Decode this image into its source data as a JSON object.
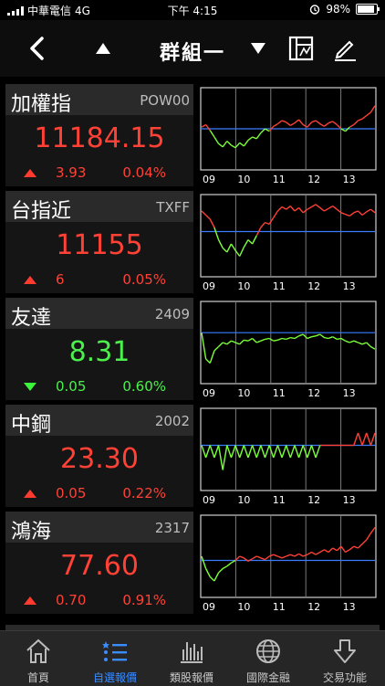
{
  "status": {
    "carrier": "中華電信",
    "network": "4G",
    "time": "下午 4:15",
    "battery": "98%"
  },
  "header": {
    "title": "群組一"
  },
  "colors": {
    "up": "#ff4136",
    "down": "#4cf04c",
    "accent": "#3b8cff"
  },
  "stocks": [
    {
      "name": "加權指",
      "code": "POW00",
      "price": "11184.15",
      "change": "3.93",
      "pct": "0.04%",
      "dir": "up",
      "chart": {
        "x_labels": [
          "09",
          "10",
          "11",
          "12",
          "13"
        ],
        "ref": 0.5,
        "series": [
          0.52,
          0.55,
          0.48,
          0.4,
          0.32,
          0.28,
          0.35,
          0.3,
          0.27,
          0.33,
          0.29,
          0.36,
          0.4,
          0.38,
          0.45,
          0.5,
          0.47,
          0.53,
          0.56,
          0.6,
          0.58,
          0.54,
          0.57,
          0.61,
          0.55,
          0.52,
          0.58,
          0.6,
          0.56,
          0.53,
          0.57,
          0.59,
          0.55,
          0.5,
          0.47,
          0.52,
          0.55,
          0.6,
          0.62,
          0.66,
          0.7,
          0.78
        ]
      }
    },
    {
      "name": "台指近",
      "code": "TXFF",
      "price": "11155",
      "change": "6",
      "pct": "0.05%",
      "dir": "up",
      "chart": {
        "x_labels": [
          "09",
          "10",
          "11",
          "12",
          "13"
        ],
        "ref": 0.55,
        "series": [
          0.8,
          0.75,
          0.7,
          0.6,
          0.45,
          0.35,
          0.3,
          0.4,
          0.32,
          0.25,
          0.36,
          0.45,
          0.4,
          0.5,
          0.6,
          0.66,
          0.64,
          0.72,
          0.8,
          0.85,
          0.82,
          0.86,
          0.8,
          0.84,
          0.78,
          0.82,
          0.85,
          0.88,
          0.84,
          0.8,
          0.83,
          0.86,
          0.82,
          0.78,
          0.76,
          0.74,
          0.78,
          0.8,
          0.75,
          0.79,
          0.82,
          0.78
        ]
      }
    },
    {
      "name": "友達",
      "code": "2409",
      "price": "8.31",
      "change": "0.05",
      "pct": "0.60%",
      "dir": "down",
      "chart": {
        "x_labels": [
          "09",
          "10",
          "11",
          "12",
          "13"
        ],
        "ref": 0.62,
        "series": [
          0.62,
          0.3,
          0.25,
          0.4,
          0.45,
          0.5,
          0.48,
          0.52,
          0.5,
          0.48,
          0.53,
          0.52,
          0.55,
          0.5,
          0.52,
          0.54,
          0.55,
          0.52,
          0.53,
          0.55,
          0.54,
          0.56,
          0.55,
          0.58,
          0.6,
          0.55,
          0.57,
          0.58,
          0.6,
          0.56,
          0.55,
          0.57,
          0.54,
          0.55,
          0.52,
          0.5,
          0.52,
          0.5,
          0.48,
          0.5,
          0.45,
          0.42
        ]
      }
    },
    {
      "name": "中鋼",
      "code": "2002",
      "price": "23.30",
      "change": "0.05",
      "pct": "0.22%",
      "dir": "up",
      "chart": {
        "x_labels": [
          "09",
          "10",
          "11",
          "12",
          "13"
        ],
        "ref": 0.55,
        "series": [
          0.55,
          0.4,
          0.55,
          0.4,
          0.55,
          0.25,
          0.55,
          0.4,
          0.55,
          0.4,
          0.55,
          0.4,
          0.55,
          0.4,
          0.55,
          0.4,
          0.55,
          0.4,
          0.55,
          0.4,
          0.55,
          0.4,
          0.55,
          0.4,
          0.55,
          0.4,
          0.55,
          0.4,
          0.55,
          0.55,
          0.55,
          0.55,
          0.55,
          0.55,
          0.55,
          0.55,
          0.55,
          0.7,
          0.55,
          0.7,
          0.55,
          0.7
        ]
      }
    },
    {
      "name": "鴻海",
      "code": "2317",
      "price": "77.60",
      "change": "0.70",
      "pct": "0.91%",
      "dir": "up",
      "chart": {
        "x_labels": [
          "09",
          "10",
          "11",
          "12",
          "13"
        ],
        "ref": 0.45,
        "series": [
          0.5,
          0.35,
          0.25,
          0.2,
          0.3,
          0.35,
          0.38,
          0.42,
          0.45,
          0.5,
          0.48,
          0.44,
          0.47,
          0.5,
          0.48,
          0.46,
          0.5,
          0.52,
          0.5,
          0.48,
          0.5,
          0.52,
          0.5,
          0.53,
          0.5,
          0.52,
          0.55,
          0.52,
          0.55,
          0.58,
          0.55,
          0.6,
          0.57,
          0.62,
          0.55,
          0.58,
          0.62,
          0.6,
          0.65,
          0.7,
          0.78,
          0.85
        ]
      }
    }
  ],
  "tabs": [
    {
      "label": "首頁",
      "icon": "home-icon"
    },
    {
      "label": "自選報價",
      "icon": "list-icon",
      "active": true
    },
    {
      "label": "類股報價",
      "icon": "bar-chart-icon"
    },
    {
      "label": "國際金融",
      "icon": "globe-icon"
    },
    {
      "label": "交易功能",
      "icon": "download-icon"
    }
  ]
}
